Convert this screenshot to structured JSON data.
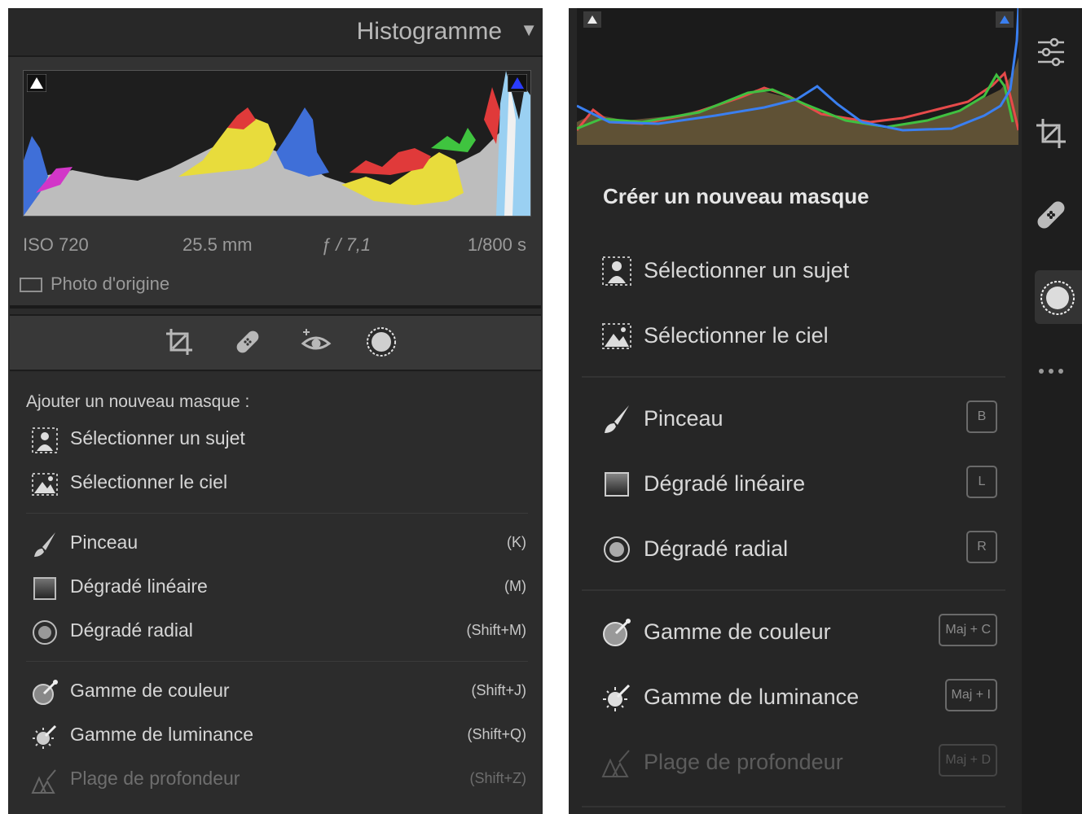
{
  "left_panel": {
    "header": {
      "title": "Histogramme",
      "collapse_glyph": "▼"
    },
    "exif": {
      "iso": "ISO 720",
      "focal": "25.5 mm",
      "aperture": "ƒ / 7,1",
      "shutter": "1/800 s"
    },
    "original_photo_label": "Photo d'origine",
    "tools": [
      "crop-icon",
      "healing-icon",
      "red-eye-icon",
      "masking-icon"
    ],
    "add_mask_label": "Ajouter un nouveau masque :",
    "items": {
      "subject": {
        "label": "Sélectionner un sujet",
        "shortcut": ""
      },
      "sky": {
        "label": "Sélectionner le ciel",
        "shortcut": ""
      },
      "brush": {
        "label": "Pinceau",
        "shortcut": "(K)"
      },
      "linear": {
        "label": "Dégradé linéaire",
        "shortcut": "(M)"
      },
      "radial": {
        "label": "Dégradé radial",
        "shortcut": "(Shift+M)"
      },
      "color": {
        "label": "Gamme de couleur",
        "shortcut": "(Shift+J)"
      },
      "luminance": {
        "label": "Gamme de luminance",
        "shortcut": "(Shift+Q)"
      },
      "depth": {
        "label": "Plage de profondeur",
        "shortcut": "(Shift+Z)"
      }
    }
  },
  "right_panel": {
    "title": "Créer un nouveau masque",
    "items": {
      "subject": {
        "label": "Sélectionner un sujet"
      },
      "sky": {
        "label": "Sélectionner le ciel"
      },
      "brush": {
        "label": "Pinceau",
        "key": "B"
      },
      "linear": {
        "label": "Dégradé linéaire",
        "key": "L"
      },
      "radial": {
        "label": "Dégradé radial",
        "key": "R"
      },
      "color": {
        "label": "Gamme de couleur",
        "key": "Maj + C"
      },
      "luminance": {
        "label": "Gamme de luminance",
        "key": "Maj + I"
      },
      "depth": {
        "label": "Plage de profondeur",
        "key": "Maj + D"
      }
    },
    "rail_icons": [
      "sliders-icon",
      "crop-icon",
      "healing-icon",
      "masking-icon",
      "more-icon"
    ]
  },
  "colors": {
    "panel_bg": "#2b2b2b",
    "text": "#d6d6d6",
    "dim_text": "#6e6e6e",
    "hist_red": "#e8323c",
    "hist_green": "#3fc43f",
    "hist_blue": "#3a7ff0",
    "hist_yellow": "#f0e040"
  }
}
